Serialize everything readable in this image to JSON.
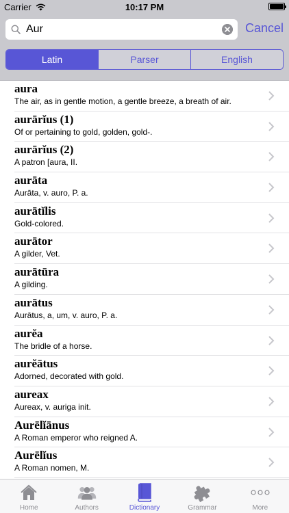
{
  "status_bar": {
    "carrier": "Carrier",
    "time": "10:17 PM",
    "battery_level": 1.0
  },
  "search": {
    "value": "Aur",
    "cancel_label": "Cancel"
  },
  "segments": [
    {
      "label": "Latin",
      "selected": true
    },
    {
      "label": "Parser",
      "selected": false
    },
    {
      "label": "English",
      "selected": false
    }
  ],
  "results": [
    {
      "word": "aura",
      "definition": "The air, as in gentle motion, a gentle breeze, a breath of air."
    },
    {
      "word": "aurārĭus (1)",
      "definition": "Of or pertaining to gold, golden, gold-."
    },
    {
      "word": "aurārĭus (2)",
      "definition": "A patron [aura, II."
    },
    {
      "word": "aurāta",
      "definition": "Aurāta, v. auro, P. a."
    },
    {
      "word": "aurātĭlis",
      "definition": "Gold-colored."
    },
    {
      "word": "aurātor",
      "definition": "A gilder, Vet."
    },
    {
      "word": "aurātūra",
      "definition": "A gilding."
    },
    {
      "word": "aurātus",
      "definition": "Aurātus, a, um, v. auro, P. a."
    },
    {
      "word": "aurĕa",
      "definition": "The bridle of a horse."
    },
    {
      "word": "aurĕātus",
      "definition": "Adorned, decorated with gold."
    },
    {
      "word": "aureax",
      "definition": "Aureax, v. auriga init."
    },
    {
      "word": "Aurēlĭānus",
      "definition": "A Roman emperor who reigned A."
    },
    {
      "word": "Aurēlĭus",
      "definition": "A Roman nomen, M."
    }
  ],
  "tabs": [
    {
      "label": "Home",
      "icon": "home-icon",
      "active": false
    },
    {
      "label": "Authors",
      "icon": "authors-icon",
      "active": false
    },
    {
      "label": "Dictionary",
      "icon": "dictionary-icon",
      "active": true
    },
    {
      "label": "Grammar",
      "icon": "grammar-icon",
      "active": false
    },
    {
      "label": "More",
      "icon": "more-icon",
      "active": false
    }
  ],
  "colors": {
    "accent": "#5856d6",
    "header_bg": "#c9c9ce",
    "inactive_tab": "#8e8e93"
  }
}
